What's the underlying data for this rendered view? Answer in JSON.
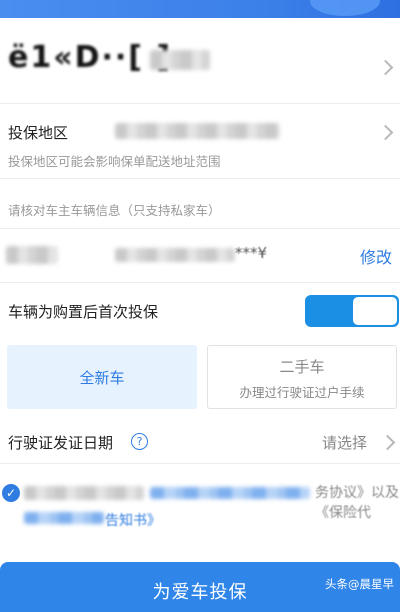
{
  "vehicle": {
    "plate_text": "ё1«D··[ ]"
  },
  "region": {
    "label": "投保地区",
    "hint": "投保地区可能会影响保单配送地址范围"
  },
  "verify_hint": "请核对车主车辆信息（只支持私家车）",
  "owner": {
    "masked_id": "***¥",
    "edit_label": "修改"
  },
  "first_insure": {
    "label": "车辆为购置后首次投保",
    "enabled": true
  },
  "car_type": {
    "new_label": "全新车",
    "used_label": "二手车",
    "used_desc": "办理过行驶证过户手续",
    "selected": "new"
  },
  "license_date": {
    "label": "行驶证发证日期",
    "help_icon": "?",
    "value": "请选择"
  },
  "agreement": {
    "text1": "务协议》以及《保险代",
    "text2": "告知书》",
    "checked": true
  },
  "submit_label": "为爱车投保",
  "watermark": "头条@晨星早"
}
